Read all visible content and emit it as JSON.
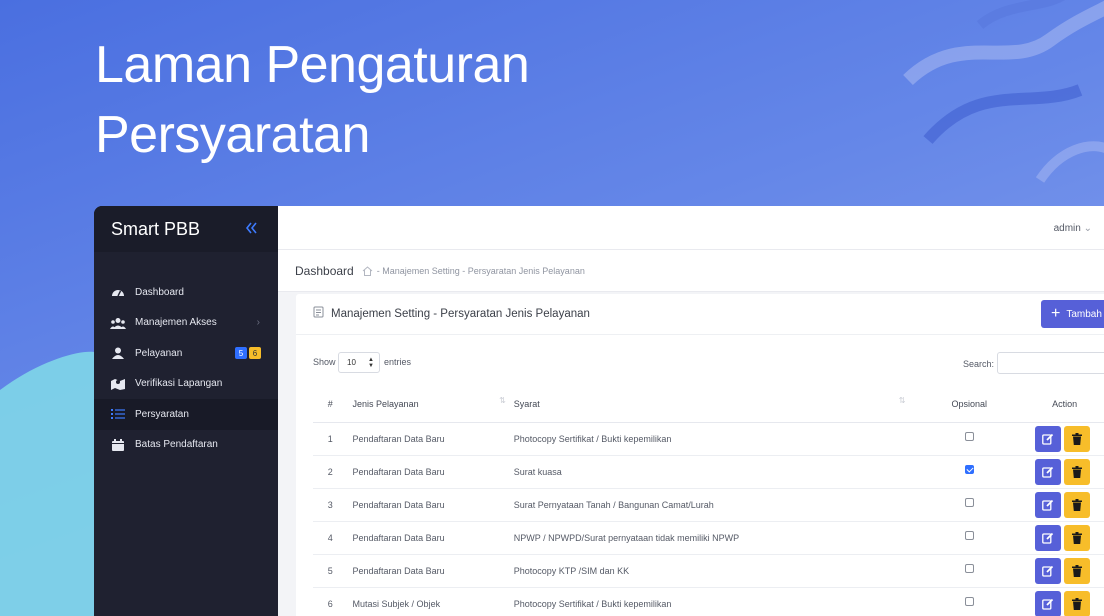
{
  "hero": {
    "line1": "Laman Pengaturan",
    "line2": "Persyaratan"
  },
  "sidebar": {
    "brand": "Smart PBB",
    "items": [
      {
        "label": "Dashboard",
        "icon": "speedometer-icon"
      },
      {
        "label": "Manajemen Akses",
        "icon": "users-icon",
        "has_submenu": true
      },
      {
        "label": "Pelayanan",
        "icon": "user-icon",
        "badges": [
          "5",
          "6"
        ]
      },
      {
        "label": "Verifikasi Lapangan",
        "icon": "map-icon"
      },
      {
        "label": "Persyaratan",
        "icon": "list-icon",
        "active": true
      },
      {
        "label": "Batas Pendaftaran",
        "icon": "calendar-icon"
      }
    ]
  },
  "topbar": {
    "user": "admin"
  },
  "breadcrumb": {
    "title": "Dashboard",
    "trail": "- Manajemen Setting - Persyaratan Jenis Pelayanan"
  },
  "card": {
    "title": "Manajemen Setting - Persyaratan Jenis Pelayanan",
    "add_label": "Tambah"
  },
  "table_controls": {
    "show_label": "Show",
    "entries_value": "10",
    "entries_label": "entries",
    "search_label": "Search:"
  },
  "table": {
    "headers": [
      "#",
      "Jenis Pelayanan",
      "Syarat",
      "Opsional",
      "Action"
    ],
    "rows": [
      {
        "no": "1",
        "jenis": "Pendaftaran Data Baru",
        "syarat": "Photocopy Sertifikat / Bukti kepemilikan",
        "opsional": false
      },
      {
        "no": "2",
        "jenis": "Pendaftaran Data Baru",
        "syarat": "Surat kuasa",
        "opsional": true
      },
      {
        "no": "3",
        "jenis": "Pendaftaran Data Baru",
        "syarat": "Surat Pernyataan Tanah / Bangunan Camat/Lurah",
        "opsional": false
      },
      {
        "no": "4",
        "jenis": "Pendaftaran Data Baru",
        "syarat": "NPWP / NPWPD/Surat pernyataan tidak memiliki NPWP",
        "opsional": false
      },
      {
        "no": "5",
        "jenis": "Pendaftaran Data Baru",
        "syarat": "Photocopy KTP /SIM dan KK",
        "opsional": false
      },
      {
        "no": "6",
        "jenis": "Mutasi Subjek / Objek",
        "syarat": "Photocopy Sertifikat / Bukti kepemilikan",
        "opsional": false
      }
    ]
  },
  "colors": {
    "primary": "#5660d8",
    "warning": "#f7bd2a",
    "sidebar_bg": "#1f2130"
  }
}
